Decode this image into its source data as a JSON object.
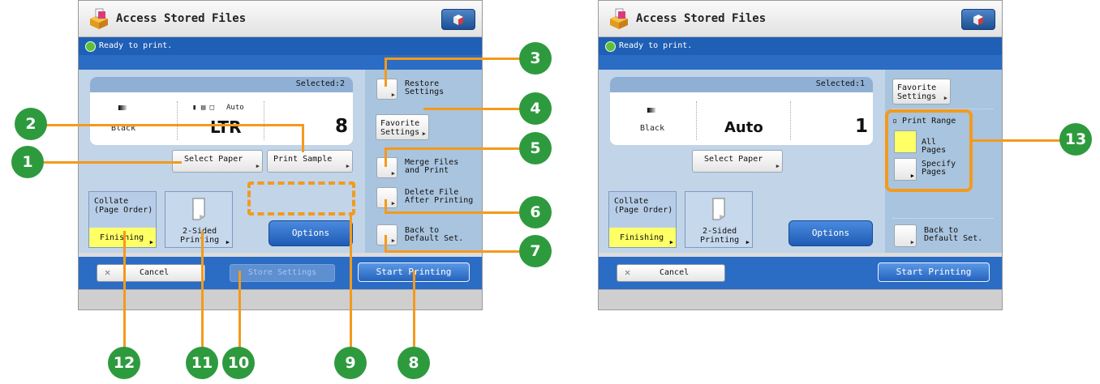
{
  "left": {
    "title": "Access Stored Files",
    "status": "Ready to print.",
    "selected": "Selected:2",
    "color_mode": "Black",
    "paper_size": "LTR",
    "paper_auto": "Auto",
    "copies": "8",
    "select_paper": "Select Paper",
    "print_sample": "Print Sample",
    "restore_settings": "Restore\nSettings",
    "favorite_settings": "Favorite\nSettings",
    "merge_files": "Merge Files\nand Print",
    "delete_file": "Delete File\nAfter Printing",
    "back_default": "Back to\nDefault Set.",
    "collate": "Collate\n(Page Order)",
    "finishing": "Finishing",
    "two_sided": "2-Sided\nPrinting",
    "options": "Options",
    "cancel": "Cancel",
    "store_settings": "Store Settings",
    "start_printing": "Start Printing"
  },
  "right": {
    "title": "Access Stored Files",
    "status": "Ready to print.",
    "selected": "Selected:1",
    "color_mode": "Black",
    "paper_size": "Auto",
    "copies": "1",
    "select_paper": "Select Paper",
    "favorite_settings": "Favorite\nSettings",
    "print_range": "Print Range",
    "all_pages": "All Pages",
    "specify_pages": "Specify\nPages",
    "back_default": "Back to\nDefault Set.",
    "collate": "Collate\n(Page Order)",
    "finishing": "Finishing",
    "two_sided": "2-Sided\nPrinting",
    "options": "Options",
    "cancel": "Cancel",
    "start_printing": "Start Printing"
  },
  "callouts": [
    "1",
    "2",
    "3",
    "4",
    "5",
    "6",
    "7",
    "8",
    "9",
    "10",
    "11",
    "12",
    "13"
  ],
  "colors": {
    "callout": "#2e9a3e",
    "leader": "#f39a1d",
    "status_bar": "#1f5fb5",
    "finishing": "#ffff66"
  }
}
